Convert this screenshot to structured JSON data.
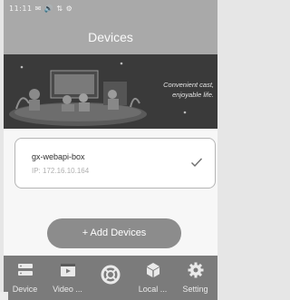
{
  "status_bar": {
    "text": "11:11 ✉ 🔊 ⇅ ⚙"
  },
  "header": {
    "title": "Devices"
  },
  "banner": {
    "caption_line1": "Convenient cast,",
    "caption_line2": "enjoyable life."
  },
  "device": {
    "name": "gx-webapi-box",
    "ip": "IP: 172.16.10.164",
    "selected": true
  },
  "add_button": {
    "label": "+ Add Devices"
  },
  "tabs": [
    {
      "label": "Device",
      "icon": "device-icon"
    },
    {
      "label": "Video ...",
      "icon": "video-icon"
    },
    {
      "label": "",
      "icon": "lifebuoy-icon"
    },
    {
      "label": "Local ...",
      "icon": "cube-icon"
    },
    {
      "label": "Setting",
      "icon": "gear-icon"
    }
  ],
  "colors": {
    "header": "#a9a9a9",
    "tab_bar": "#7b7b7b",
    "button": "#8c8c8c",
    "card_border": "#b5b5b5"
  }
}
